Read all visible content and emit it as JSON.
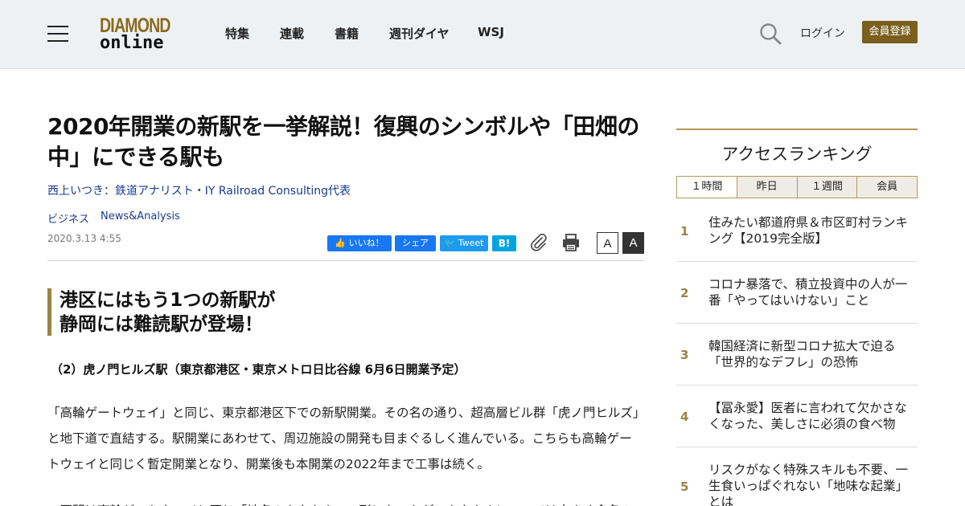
{
  "header": {
    "logo_line1": "DIAMOND",
    "logo_line2": "online",
    "nav": [
      "特集",
      "連載",
      "書籍",
      "週刊ダイヤ",
      "WSJ"
    ],
    "login": "ログイン",
    "register": "会員登録"
  },
  "article": {
    "title": "2020年開業の新駅を一挙解説！復興のシンボルや「田畑の中」にできる駅も",
    "author": "西上いつき：鉄道アナリスト・IY Railroad Consulting代表",
    "tags": [
      "ビジネス",
      "News&Analysis"
    ],
    "date": "2020.3.13 4:55",
    "share": {
      "like": "いいね！",
      "share": "シェア",
      "tweet": "Tweet",
      "hatena": "B!"
    },
    "font_small": "A",
    "font_large": "A",
    "subhead_line1": "港区にはもう1つの新駅が",
    "subhead_line2": "静岡には難読駅が登場！",
    "lead": "（2）虎ノ門ヒルズ駅（東京都港区・東京メトロ日比谷線 6月6日開業予定）",
    "body": "「高輪ゲートウェイ」と同じ、東京都港区下での新駅開業。その名の通り、超高層ビル群「虎ノ門ヒルズ」と地下道で直結する。駅開業にあわせて、周辺施設の開発も目まぐるしく進んでいる。こちらも高輪ゲートウェイと同じく暫定開業となり、開業後も本開業の2022年まで工事は続く。",
    "body2": "　同駅は高輪ゲートウェイと同じ「地名＋カタカナ」の形になったが、カタカナについては大きく命名の"
  },
  "ranking": {
    "title": "アクセスランキング",
    "tabs": [
      "１時間",
      "昨日",
      "１週間",
      "会員"
    ],
    "items": [
      {
        "num": "1",
        "text": "住みたい都道府県＆市区町村ランキング【2019完全版】"
      },
      {
        "num": "2",
        "text": "コロナ暴落で、積立投資中の人が一番「やってはいけない」こと"
      },
      {
        "num": "3",
        "text": "韓国経済に新型コロナ拡大で迫る「世界的なデフレ」の恐怖"
      },
      {
        "num": "4",
        "text": "【冨永愛】医者に言われて欠かさなくなった、美しさに必須の食べ物"
      },
      {
        "num": "5",
        "text": "リスクがなく特殊スキルも不要、一生食いっぱぐれない「地味な起業」とは"
      }
    ]
  },
  "colors": {
    "accent": "#9c8242",
    "register_bg": "#7a5f1e",
    "link": "#1a3a8c"
  },
  "icons": [
    "menu-icon",
    "search-icon",
    "paperclip-icon",
    "print-icon",
    "facebook-icon",
    "twitter-icon"
  ]
}
